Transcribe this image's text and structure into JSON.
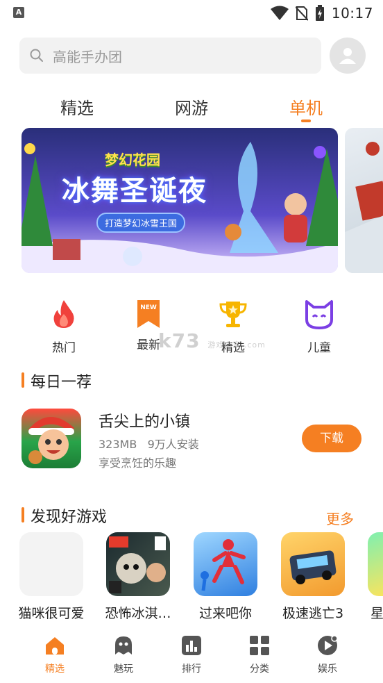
{
  "status_bar": {
    "time": "10:17",
    "app_icon_letter": "A"
  },
  "search": {
    "placeholder": "高能手办团"
  },
  "tabs": [
    {
      "label": "精选",
      "active": false
    },
    {
      "label": "网游",
      "active": false
    },
    {
      "label": "单机",
      "active": true
    }
  ],
  "banner": {
    "logo_text": "梦幻花园",
    "title": "冰舞圣诞夜",
    "subtitle": "打造梦幻冰雪王国"
  },
  "categories": [
    {
      "label": "热门",
      "icon": "fire-icon"
    },
    {
      "label": "最新",
      "icon": "new-badge-icon",
      "badge": "NEW"
    },
    {
      "label": "精选",
      "icon": "trophy-icon"
    },
    {
      "label": "儿童",
      "icon": "cat-face-icon"
    }
  ],
  "watermark": {
    "text": "k73",
    "sub": "游戏之家 .com"
  },
  "daily": {
    "section_title": "每日一荐",
    "name": "舌尖上的小镇",
    "size": "323MB",
    "installs": "9万人安装",
    "desc": "享受烹饪的乐趣",
    "button": "下载"
  },
  "discover": {
    "section_title": "发现好游戏",
    "more": "更多",
    "games": [
      {
        "name": "猫咪很可爱"
      },
      {
        "name": "恐怖冰淇…"
      },
      {
        "name": "过来吧你"
      },
      {
        "name": "极速逃亡3"
      },
      {
        "name": "星"
      }
    ]
  },
  "bottom_nav": [
    {
      "label": "精选",
      "icon": "home-icon",
      "active": true
    },
    {
      "label": "魅玩",
      "icon": "ghost-icon",
      "active": false
    },
    {
      "label": "排行",
      "icon": "ranking-icon",
      "active": false
    },
    {
      "label": "分类",
      "icon": "grid-icon",
      "active": false
    },
    {
      "label": "娱乐",
      "icon": "play-icon",
      "active": false
    }
  ],
  "colors": {
    "accent": "#f57f22",
    "search_bg": "#f2f2f2"
  }
}
